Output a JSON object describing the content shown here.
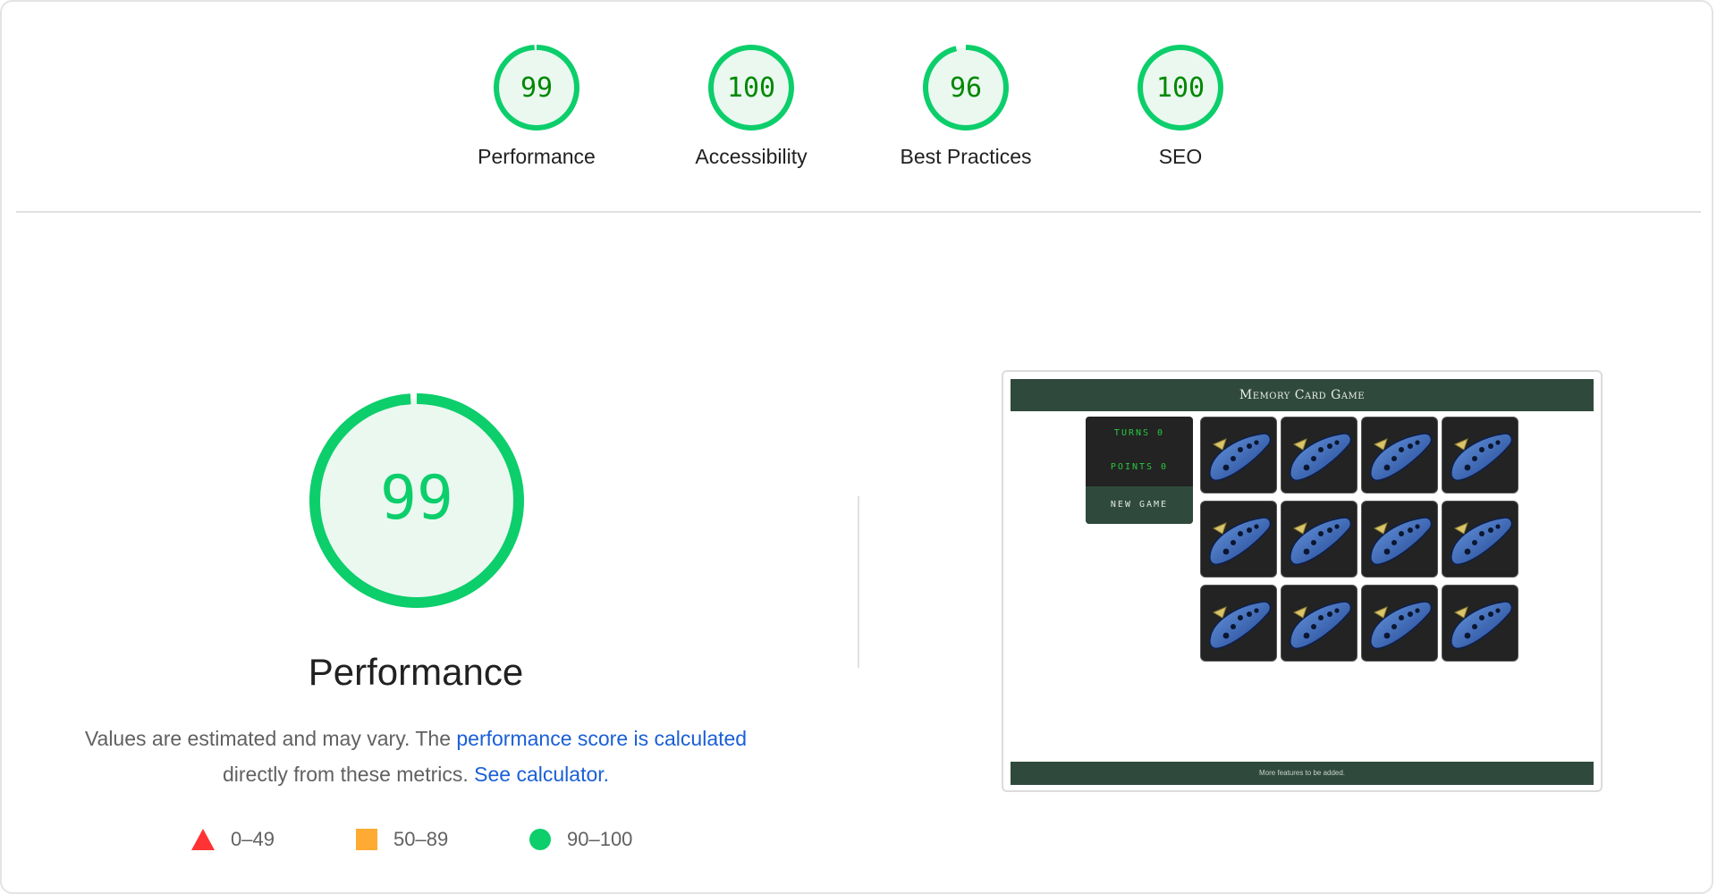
{
  "scores": [
    {
      "label": "Performance",
      "value": 99
    },
    {
      "label": "Accessibility",
      "value": 100
    },
    {
      "label": "Best Practices",
      "value": 96
    },
    {
      "label": "SEO",
      "value": 100
    }
  ],
  "performance": {
    "score": 99,
    "title": "Performance",
    "desc_text_1": "Values are estimated and may vary. The ",
    "desc_link_1": "performance score is calculated",
    "desc_text_2": "directly from these metrics.",
    "desc_link_2": "See calculator."
  },
  "legend": [
    {
      "shape": "triangle",
      "range": "0–49",
      "color": "#ff3333"
    },
    {
      "shape": "square",
      "range": "50–89",
      "color": "#ffaa33"
    },
    {
      "shape": "circle",
      "range": "90–100",
      "color": "#0cce6b"
    }
  ],
  "colors": {
    "pass": "#0cce6b",
    "pass_fill": "#eaf8f0",
    "pass_text": "#008800",
    "link": "#1a5fd6",
    "game_green": "#2f4a3c"
  },
  "screenshot": {
    "header": "Memory Card Game",
    "turns": "TURNS 0",
    "points": "POINTS 0",
    "new_game": "NEW GAME",
    "footer": "More features to be added.",
    "card_count": 12
  }
}
